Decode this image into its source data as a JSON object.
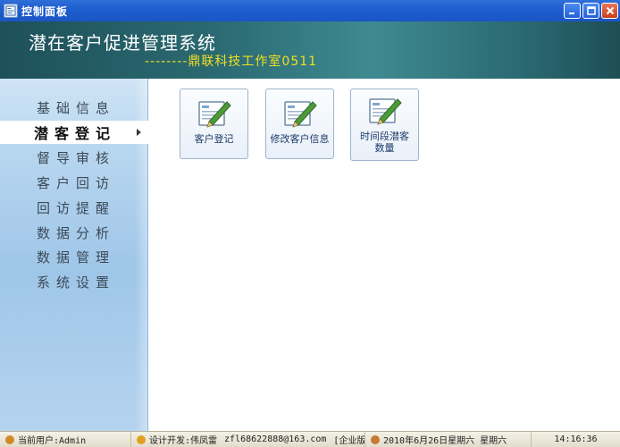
{
  "window": {
    "title": "控制面板"
  },
  "header": {
    "title": "潜在客户促进管理系统",
    "subtitle": "--------鼎联科技工作室0511"
  },
  "sidebar": {
    "items": [
      {
        "label": "基础信息",
        "active": false
      },
      {
        "label": "潜客登记",
        "active": true
      },
      {
        "label": "督导审核",
        "active": false
      },
      {
        "label": "客户回访",
        "active": false
      },
      {
        "label": "回访提醒",
        "active": false
      },
      {
        "label": "数据分析",
        "active": false
      },
      {
        "label": "数据管理",
        "active": false
      },
      {
        "label": "系统设置",
        "active": false
      }
    ]
  },
  "main": {
    "tiles": [
      {
        "label": "客户登记",
        "icon": "form-pen-icon"
      },
      {
        "label": "修改客户信息",
        "icon": "form-pen-icon"
      },
      {
        "label": "时间段潜客数量",
        "icon": "form-pen-icon"
      }
    ]
  },
  "statusbar": {
    "user": "当前用户:Admin",
    "developer": "设计开发:伟凤雷",
    "email": "zfl68622888@163.com",
    "edition": "[企业版]",
    "date": "2010年6月26日星期六 星期六",
    "time": "14:16:36"
  },
  "colors": {
    "titlebar": "#1f5fd0",
    "header": "#2b6a72",
    "subtitle": "#f0e020",
    "sidebar": "#b8d6ef"
  }
}
